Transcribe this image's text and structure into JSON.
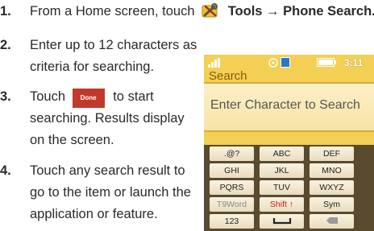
{
  "steps": [
    {
      "num": "1.",
      "before": "From a Home screen, touch",
      "bold": "Tools → Phone Search."
    },
    {
      "num": "2.",
      "lines": [
        "Enter up to 12 characters as",
        "criteria for searching."
      ]
    },
    {
      "num": "3.",
      "before": "Touch",
      "button": "Done",
      "after": "to start",
      "lines": [
        "searching. Results display",
        "on the screen."
      ]
    },
    {
      "num": "4.",
      "lines": [
        "Touch any search result to",
        "go to the item or launch the",
        "application or feature."
      ]
    }
  ],
  "phone": {
    "status_time": "3:11",
    "title": "Search",
    "placeholder": "Enter Character to Search",
    "keys": [
      [
        ".@?",
        "ABC",
        "DEF"
      ],
      [
        "GHI",
        "JKL",
        "MNO"
      ],
      [
        "PQRS",
        "TUV",
        "WXYZ"
      ],
      [
        "T9Word",
        "Shift ↑",
        "Sym"
      ],
      [
        "123",
        "space",
        "del"
      ]
    ]
  },
  "icons": {
    "tools": "tools-icon",
    "space": "space-bar-icon",
    "delete": "backspace-icon"
  },
  "colors": {
    "phone_bg": "#f3cf53",
    "done_button": "#c0392b",
    "shift_text": "#c0201a"
  }
}
